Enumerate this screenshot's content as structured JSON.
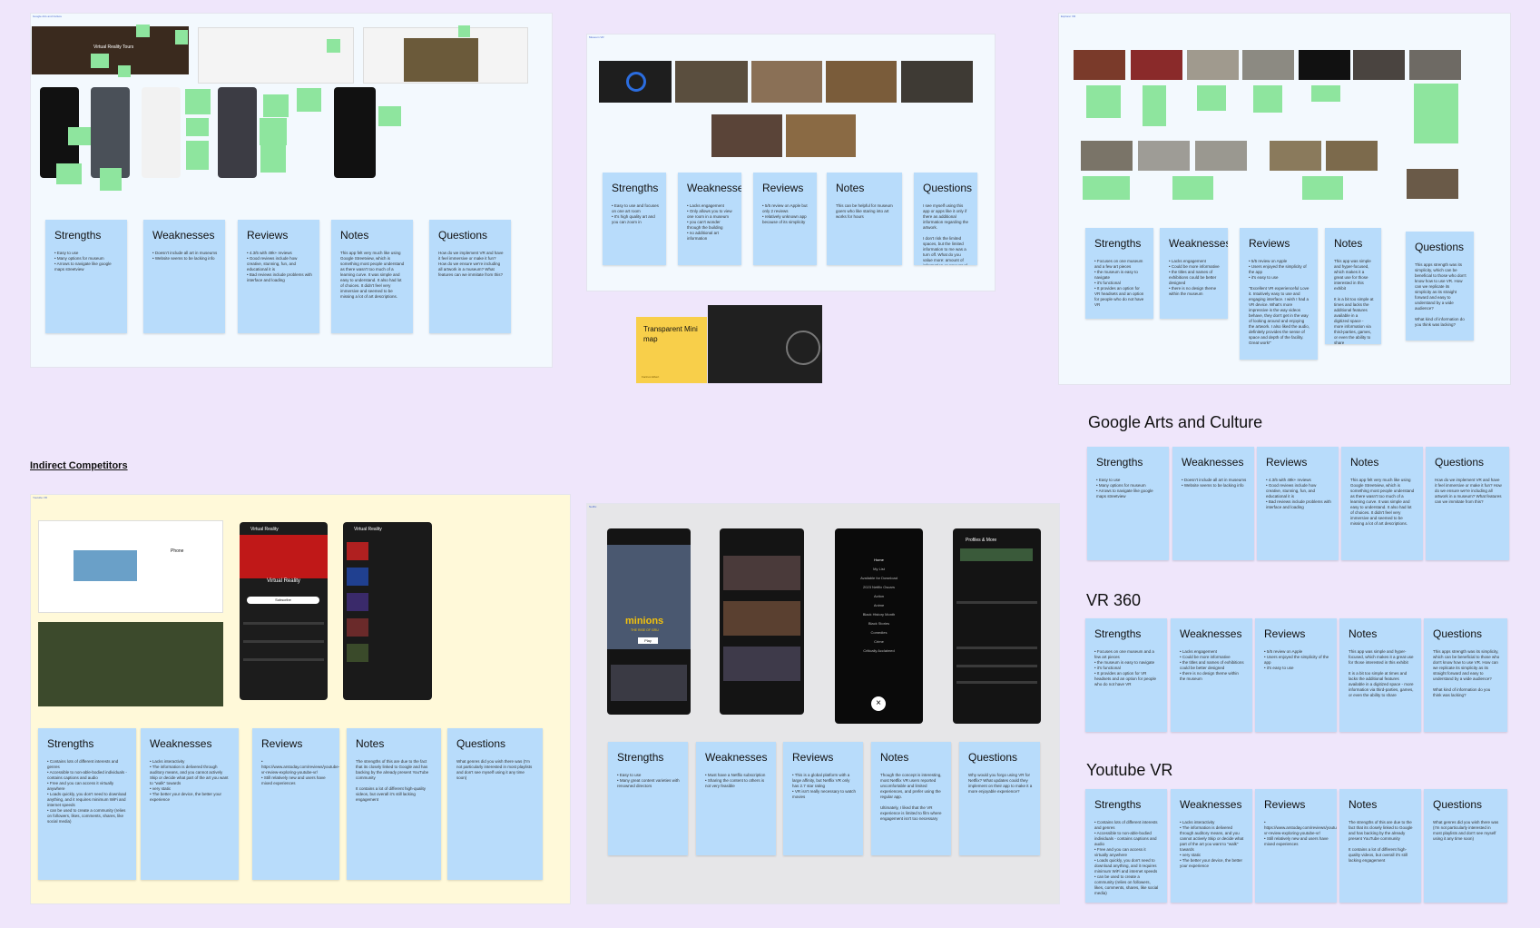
{
  "canvas": {
    "background": "#efe6fb"
  },
  "frames": {
    "google_arts_board": {
      "tag": "Google Arts and Culture"
    },
    "vr360_board": {
      "tag": "VR 360"
    },
    "youtube_board": {
      "tag": "Youtube VR"
    },
    "netflix_board": {
      "tag": "Netflix"
    },
    "museum_board": {
      "tag": "Museum VR"
    },
    "explorer_board": {
      "tag": "Explorer VR"
    }
  },
  "google_arts_thumb": {
    "title": "Virtual Reality Tours"
  },
  "sticky_note": {
    "text": "Transparent Mini map",
    "author": "Facinos Elbert"
  },
  "indirect_competitors": {
    "label": "Indirect Competitors"
  },
  "sections": {
    "google_arts": {
      "title": "Google Arts and Culture"
    },
    "vr360": {
      "title": "VR 360"
    },
    "youtube_vr": {
      "title": "Youtube VR"
    }
  },
  "youtube_phone": {
    "title": "Virtual Reality",
    "channel": "Virtual Reality",
    "button": "Subscribe"
  },
  "youtube_laptop": {
    "title": "Phone"
  },
  "netflix_phone_1": {
    "brand": "minions",
    "sub": "THE RISE OF GRU",
    "button": "Play"
  },
  "netflix_phone_3": {
    "items": [
      "Home",
      "My List",
      "Available for Download",
      "2023 Netflix Oscars",
      "Action",
      "Anime",
      "Black History Month",
      "Black Stories",
      "Comedies",
      "Crime",
      "Critically Acclaimed"
    ]
  },
  "netflix_phone_4": {
    "title": "Profiles & More"
  },
  "critique": {
    "strengths": "Strengths",
    "weaknesses": "Weaknesses",
    "reviews": "Reviews",
    "notes": "Notes",
    "questions": "Questions"
  },
  "ga_body": {
    "strengths": "• Easy to use\n• Many options for museum\n• Arrows to navigate like google maps streetview",
    "weaknesses": "• Doesn't include all art in museums\n• Website seems to be lacking info",
    "reviews": "• 4.3/5 with 49k+ reviews\n• Good reviews include how creative, stunning, fun, and educational it is\n• Bad reviews include problems with interface and loading",
    "notes": "This app felt very much like using Google Streetview, which is something most people understand as there wasn't too much of a learning curve. It was simple and easy to understand. It also had lot of choices. It didn't feel very immersive and seemed to be missing a lot of art descriptions.",
    "questions": "How do we implement VR and have it feel immersive or make it fun? How do we ensure we're including all artwork in a museum? What features can we immitate from this?"
  },
  "vr_body": {
    "strengths": "• Focuses on one museum and a few art pieces\n• the museum is easy to navigate\n• it's functional\n• It provides an option for VR headsets and an option for people who do not have VR",
    "weaknesses": "• Lacks engagement\n• Could be more informative\n• the titles and names of exhibitions could be better designed\n• there is no design theme within the museum",
    "reviews": "• 5/5 review on Apple\n• Users enjoyed the simplicity of the app\n• it's easy to use",
    "notes": "This app was simple and hyper-focused, which makes it a great use for those interested in this exhibit\n\nIt is a bit too simple at times and lacks the additional features available in a digitized space - more information via third-parties, games, or even the ability to share",
    "questions": "This apps strength was its simplicity, which can be beneficial to those who don't know how to use VR. How can we replicate its simplicity as its straight forward and easy to understand by a wide audience?\n\nWhat kind of information do you think was lacking?"
  },
  "vr_reviews_top": "• 5/5 review on Apple\n• Users enjoyed the simplicity of the app\n• it's easy to use\n\n\"Excellent VR experienceful Love it. Intuitively easy to use and engaging interface. I wish I had a VR device. What's more impressive is the way videos behave, they don't get in the way of looking around and enjoying the artwork. I also liked the audio, definitely provides the sense of space and depth of the facility. Great work!\"",
  "yt_body": {
    "strengths": "• Contains lots of different interests and genres\n• Accessible to non-able-bodied individuals - contains captions and audio\n• Free and you can access it virtually anywhere\n• Loads quickly, you don't need to download anything, and it requires minimum WiFi and internet speeds\n• can be used to create a community (relies on followers, likes, comments, shares, like social media)",
    "weaknesses": "• Lacks interactivity\n• The information is delivered through auditory means, and you cannot actively Skip or decide what part of the art you want to \"walk\" towards\n• very static\n• The better your device, the better your experience",
    "reviews": "• https://www.arstoday.com/reviews/youtube-vr-review-exploring-youtube-vr/\n• Still relatively new and users have mixed experiences",
    "notes": "The strengths of this are due to the fact that its closely linked to Google and has backing by the already present YouTube community\n\nIt contains a lot of different high-quality videos, but overall it's still lacking engagement",
    "questions": "What genres did you wish there was (I'm not particularly interested in most playlists and don't see myself using it any time soon)"
  },
  "nf_body": {
    "strengths": "• Easy to use\n• Many great content varieties with renowned directors",
    "weaknesses": "• Must have a Netflix subscription\n• Sharing the content to others is not very feasible",
    "reviews": "• This is a global platform with a large affinity, but Netflix VR only has 2.7 star rating\n• VR isn't really necessary to watch movies",
    "notes": "Though the concept is interesting, most Netflix VR users reported uncomfortable and limited experiences, and prefer using the regular app.\n\nUltimately, I liked that the VR experience is limited to film where engagement isn't too necessary",
    "questions": "Why would you forgo using VR for Netflix? What updates could they implement on their app to make it a more enjoyable experience?"
  },
  "mu_body": {
    "strengths": "• Easy to use and focuses on one art room\n• It's high quality art and you can zoom in",
    "weaknesses": "• Lacks engagement\n• Only allows you to view one room in a museum\n• you can't wonder through the building\n• no additional art information",
    "reviews": "• 5/5 review on Apple but only 2 reviews\n• relatively unknown app because of its simplicity",
    "notes": "This can be helpful for museum goers who like staring into art works for hours",
    "questions": "I see myself using this app or apps like it only if there as additional information regarding the artwork.\n\nI don't risk the limited spaces, but the limited information to me was a turn off. What do you value more: amount of information or amount of art works?"
  },
  "colors": {
    "sticky": "#b8dcfb",
    "green": "#8ee59e",
    "yellow": "#f8cf4a",
    "page": "#efe6fb"
  }
}
